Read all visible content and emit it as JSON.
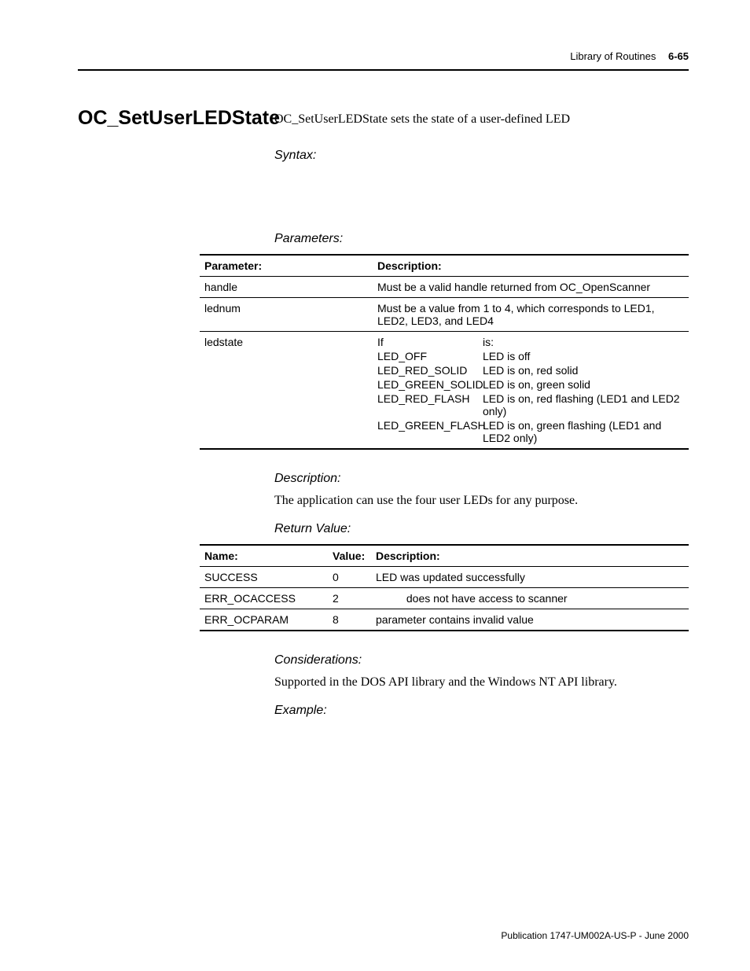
{
  "header": {
    "chapter": "Library of Routines",
    "pagenum": "6-65"
  },
  "routine": {
    "name": "OC_SetUserLEDState",
    "intro": "OC_SetUserLEDState sets the state of a user-defined LED"
  },
  "sections": {
    "syntax": "Syntax:",
    "parameters": "Parameters:",
    "description_label": "Description:",
    "return_value": "Return Value:",
    "considerations": "Considerations:",
    "example": "Example:"
  },
  "params_table": {
    "head_param": "Parameter:",
    "head_desc": "Description:",
    "rows": {
      "r0": {
        "param": "handle",
        "desc": "Must be a valid handle returned from OC_OpenScanner"
      },
      "r1": {
        "param": "lednum",
        "desc": "Must be a value from 1 to 4, which corresponds to LED1, LED2, LED3, and LED4"
      },
      "r2": {
        "param": "ledstate",
        "ls_head_if": "If",
        "ls_head_is": "is:",
        "ls0k": "LED_OFF",
        "ls0v": "LED is off",
        "ls1k": "LED_RED_SOLID",
        "ls1v": "LED is on, red solid",
        "ls2k": "LED_GREEN_SOLID",
        "ls2v": "LED is on, green solid",
        "ls3k": "LED_RED_FLASH",
        "ls3v": "LED is on, red flashing (LED1 and LED2 only)",
        "ls4k": "LED_GREEN_FLASH",
        "ls4v": "LED is on, green flashing (LED1 and LED2 only)"
      }
    }
  },
  "description_body": "The application can use the four user LEDs for any purpose.",
  "returns_table": {
    "head_name": "Name:",
    "head_value": "Value:",
    "head_desc": "Description:",
    "rows": {
      "r0": {
        "name": "SUCCESS",
        "value": "0",
        "desc": "LED was updated successfully"
      },
      "r1": {
        "name": "ERR_OCACCESS",
        "value": "2",
        "desc": "          does not have access to scanner"
      },
      "r2": {
        "name": "ERR_OCPARAM",
        "value": "8",
        "desc": "parameter contains invalid value"
      }
    }
  },
  "considerations_body": "Supported in the DOS API library and the Windows NT API library.",
  "footer": "Publication 1747-UM002A-US-P - June 2000"
}
